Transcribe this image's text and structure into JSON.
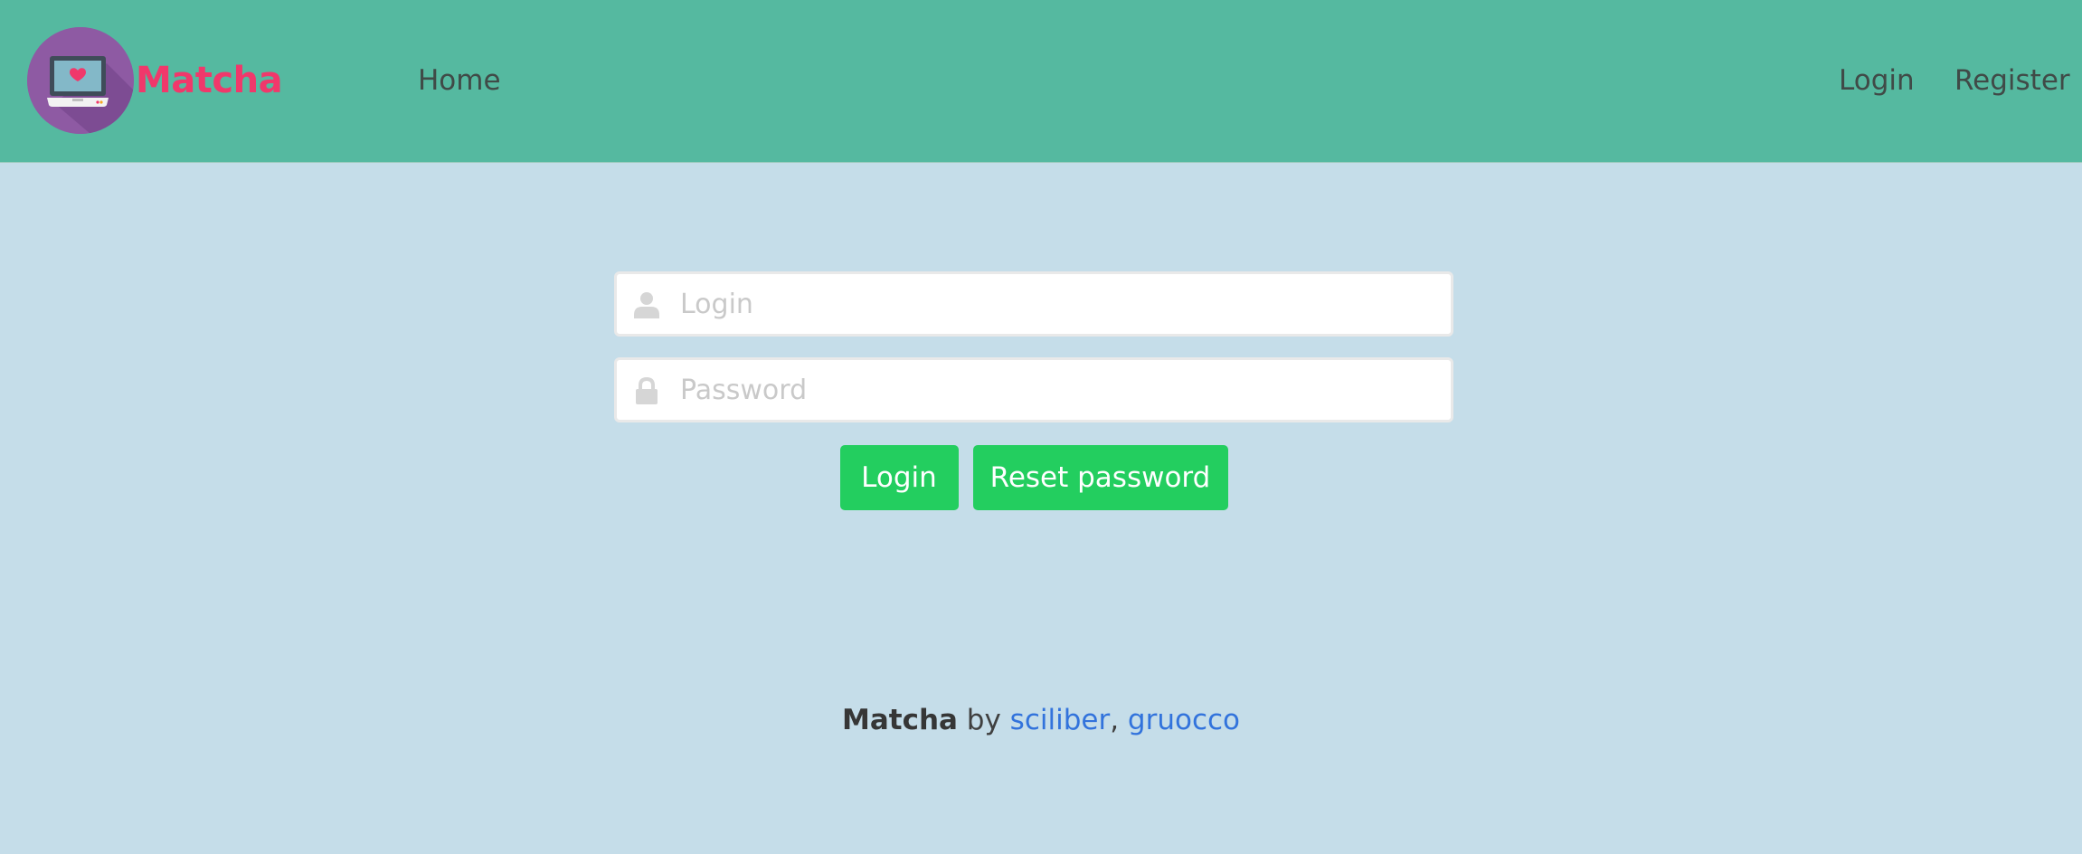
{
  "navbar": {
    "brand": "Matcha",
    "logo_icon": "laptop-heart-logo",
    "links": {
      "home": "Home",
      "login": "Login",
      "register": "Register"
    }
  },
  "login_form": {
    "login_placeholder": "Login",
    "password_placeholder": "Password",
    "login_icon": "user-icon",
    "password_icon": "lock-icon",
    "login_button": "Login",
    "reset_button": "Reset password"
  },
  "footer": {
    "app_name": "Matcha",
    "by": " by ",
    "author1": "sciliber",
    "separator": ", ",
    "author2": "gruocco"
  },
  "colors": {
    "navbar_bg": "#55b9a0",
    "page_bg": "#c5dde9",
    "brand": "#f0386b",
    "button": "#23ce5f",
    "link": "#3273dc"
  }
}
